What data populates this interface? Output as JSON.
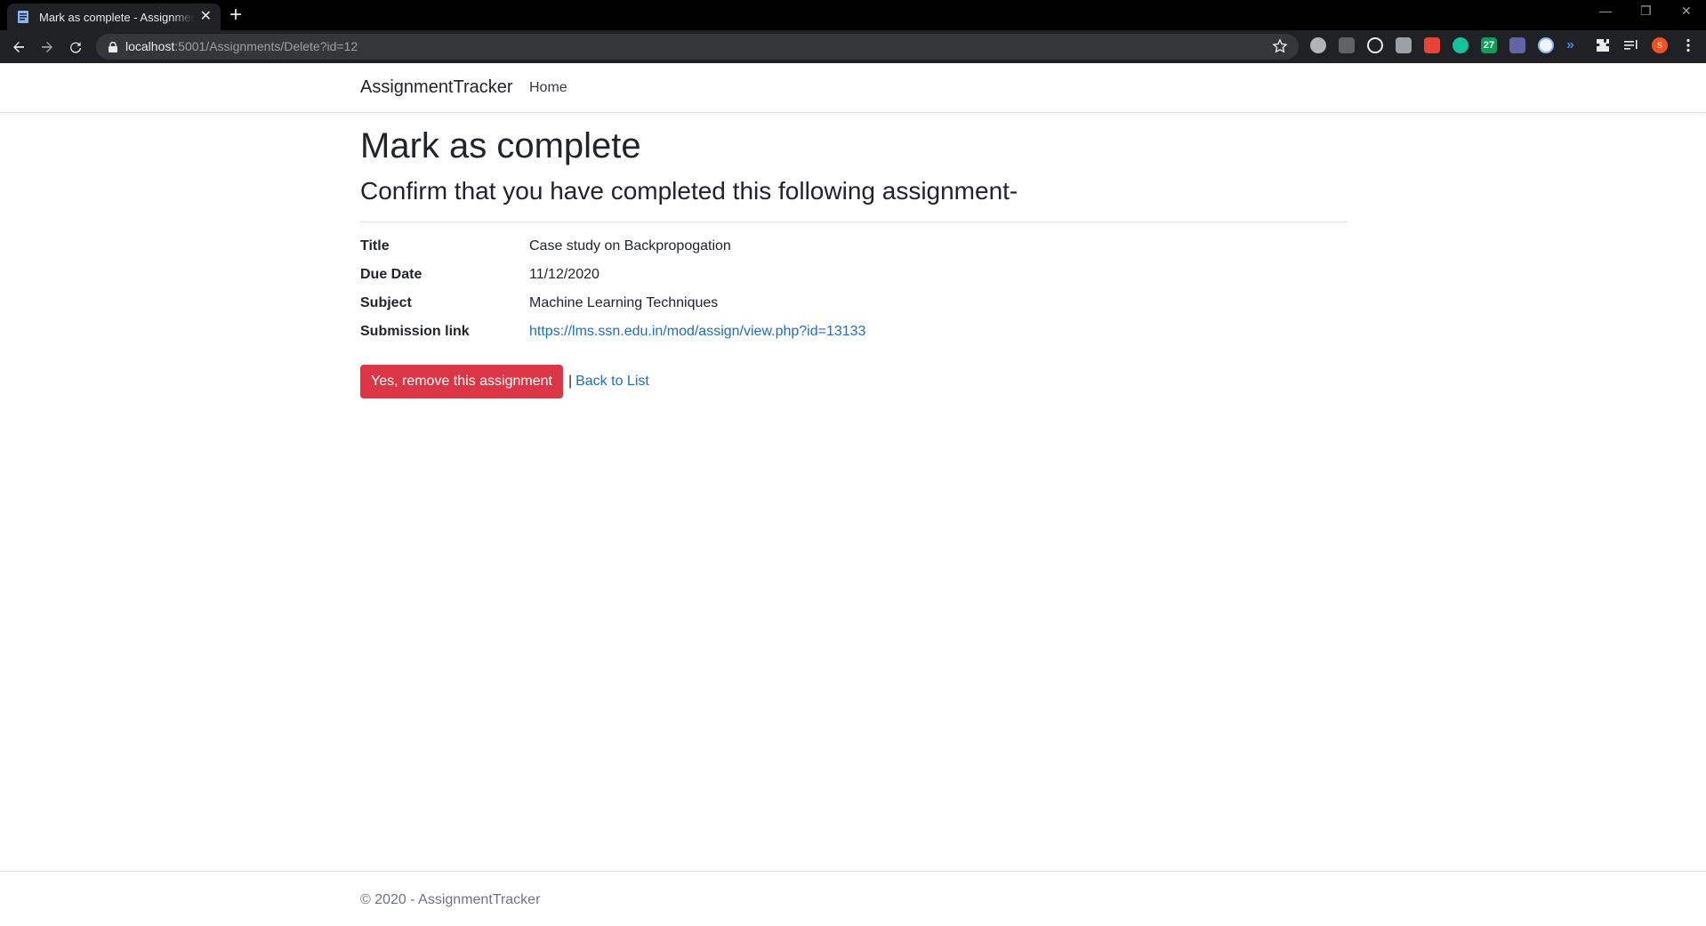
{
  "browser": {
    "tab_title": "Mark as complete - AssignmentTracker",
    "tab_close": "✕",
    "new_tab": "+",
    "url_host": "localhost",
    "url_rest": ":5001/Assignments/Delete?id=12",
    "window_controls": [
      "—",
      "❐",
      "✕"
    ],
    "extension_icons": [
      "abp-icon",
      "ext-icon-2",
      "atom-icon",
      "ext-icon-4",
      "gmail-icon",
      "grammarly-icon",
      "calendar-icon",
      "teams-icon",
      "face-icon",
      "wave-icon",
      "puzzle-icon",
      "playlist-icon",
      "profile-avatar",
      "menu-icon"
    ],
    "profile_initial": "S",
    "calendar_day": "27",
    "colors": {
      "titlebar": "#000000",
      "toolbar": "#202124",
      "omnibox": "#35363a"
    }
  },
  "navbar": {
    "brand": "AssignmentTracker",
    "home": "Home"
  },
  "page": {
    "title": "Mark as complete",
    "subtitle": "Confirm that you have completed this following assignment-"
  },
  "details": [
    {
      "label": "Title",
      "value": "Case study on Backpropogation"
    },
    {
      "label": "Due Date",
      "value": "11/12/2020"
    },
    {
      "label": "Subject",
      "value": "Machine Learning Techniques"
    },
    {
      "label": "Submission link",
      "value": "https://lms.ssn.edu.in/mod/assign/view.php?id=13133"
    }
  ],
  "actions": {
    "remove_button": "Yes, remove this assignment",
    "separator": "|",
    "back_link": "Back to List"
  },
  "footer": {
    "text": "© 2020 - AssignmentTracker"
  },
  "theme": {
    "danger": "#dc3545",
    "link": "#1b6ec2",
    "muted": "#6c757d"
  }
}
